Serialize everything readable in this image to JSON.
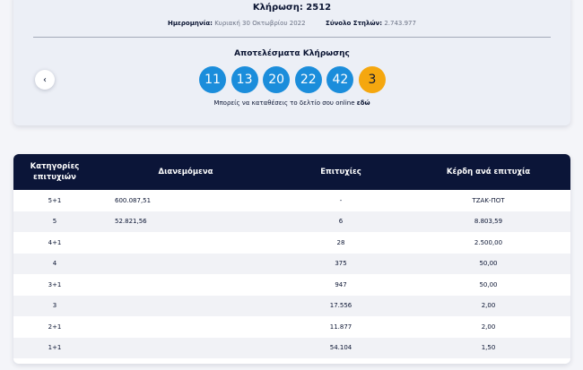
{
  "draw": {
    "title": "Κλήρωση: 2512",
    "date_label": "Ημερομηνία:",
    "date_value": "Κυριακή 30 Οκτωβρίου 2022",
    "columns_label": "Σύνολο Στηλών:",
    "columns_value": "2.743.977",
    "results_title": "Αποτελέσματα Κλήρωσης",
    "numbers": [
      "11",
      "13",
      "20",
      "22",
      "42"
    ],
    "bonus": "3",
    "prev_icon": "chevron-left-icon",
    "online_text": "Μπορείς να καταθέσεις το δελτίο σου online",
    "online_link": "εδώ",
    "colors": {
      "ball": "#1b8ddb",
      "bonus_ball": "#f5a70f"
    }
  },
  "table": {
    "headers": {
      "category_line1": "Κατηγορίες",
      "category_line2": "επιτυχιών",
      "distributed": "Διανεμόμενα",
      "winners": "Επιτυχίες",
      "prize": "Κέρδη ανά επιτυχία"
    },
    "header_color": "#0b1538",
    "rows": [
      {
        "category": "5+1",
        "distributed": "600.087,51",
        "winners": "-",
        "prize": "ΤΖΑΚ-ΠΟΤ"
      },
      {
        "category": "5",
        "distributed": "52.821,56",
        "winners": "6",
        "prize": "8.803,59"
      },
      {
        "category": "4+1",
        "distributed": "",
        "winners": "28",
        "prize": "2.500,00"
      },
      {
        "category": "4",
        "distributed": "",
        "winners": "375",
        "prize": "50,00"
      },
      {
        "category": "3+1",
        "distributed": "",
        "winners": "947",
        "prize": "50,00"
      },
      {
        "category": "3",
        "distributed": "",
        "winners": "17.556",
        "prize": "2,00"
      },
      {
        "category": "2+1",
        "distributed": "",
        "winners": "11.877",
        "prize": "2,00"
      },
      {
        "category": "1+1",
        "distributed": "",
        "winners": "54.104",
        "prize": "1,50"
      }
    ]
  }
}
